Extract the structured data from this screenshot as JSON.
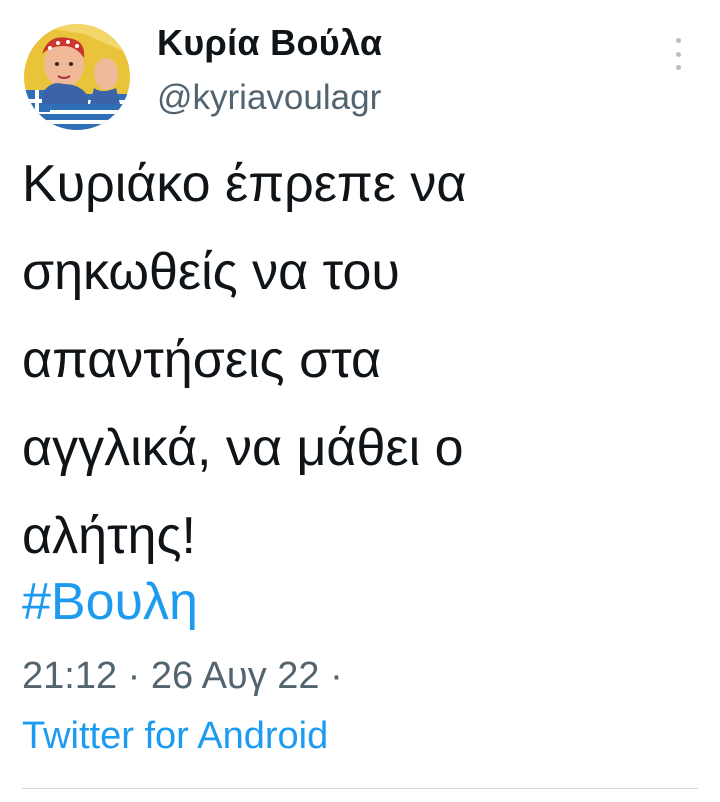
{
  "author": {
    "display_name": "Κυρία Βούλα",
    "handle": "@kyriavoulagr",
    "avatar_icon": "avatar-icon"
  },
  "tweet": {
    "text_lines": [
      "Κυριάκο έπρεπε να",
      "σηκωθείς να του",
      "απαντήσεις στα",
      "αγγλικά, να μάθει ο",
      "αλήτης!"
    ],
    "hashtag": "#Βουλη",
    "timestamp": "21:12 · 26 Αυγ 22 ·",
    "source": "Twitter for Android"
  },
  "colors": {
    "text": "#0f1419",
    "secondary": "#536471",
    "link": "#1d9bf0"
  }
}
